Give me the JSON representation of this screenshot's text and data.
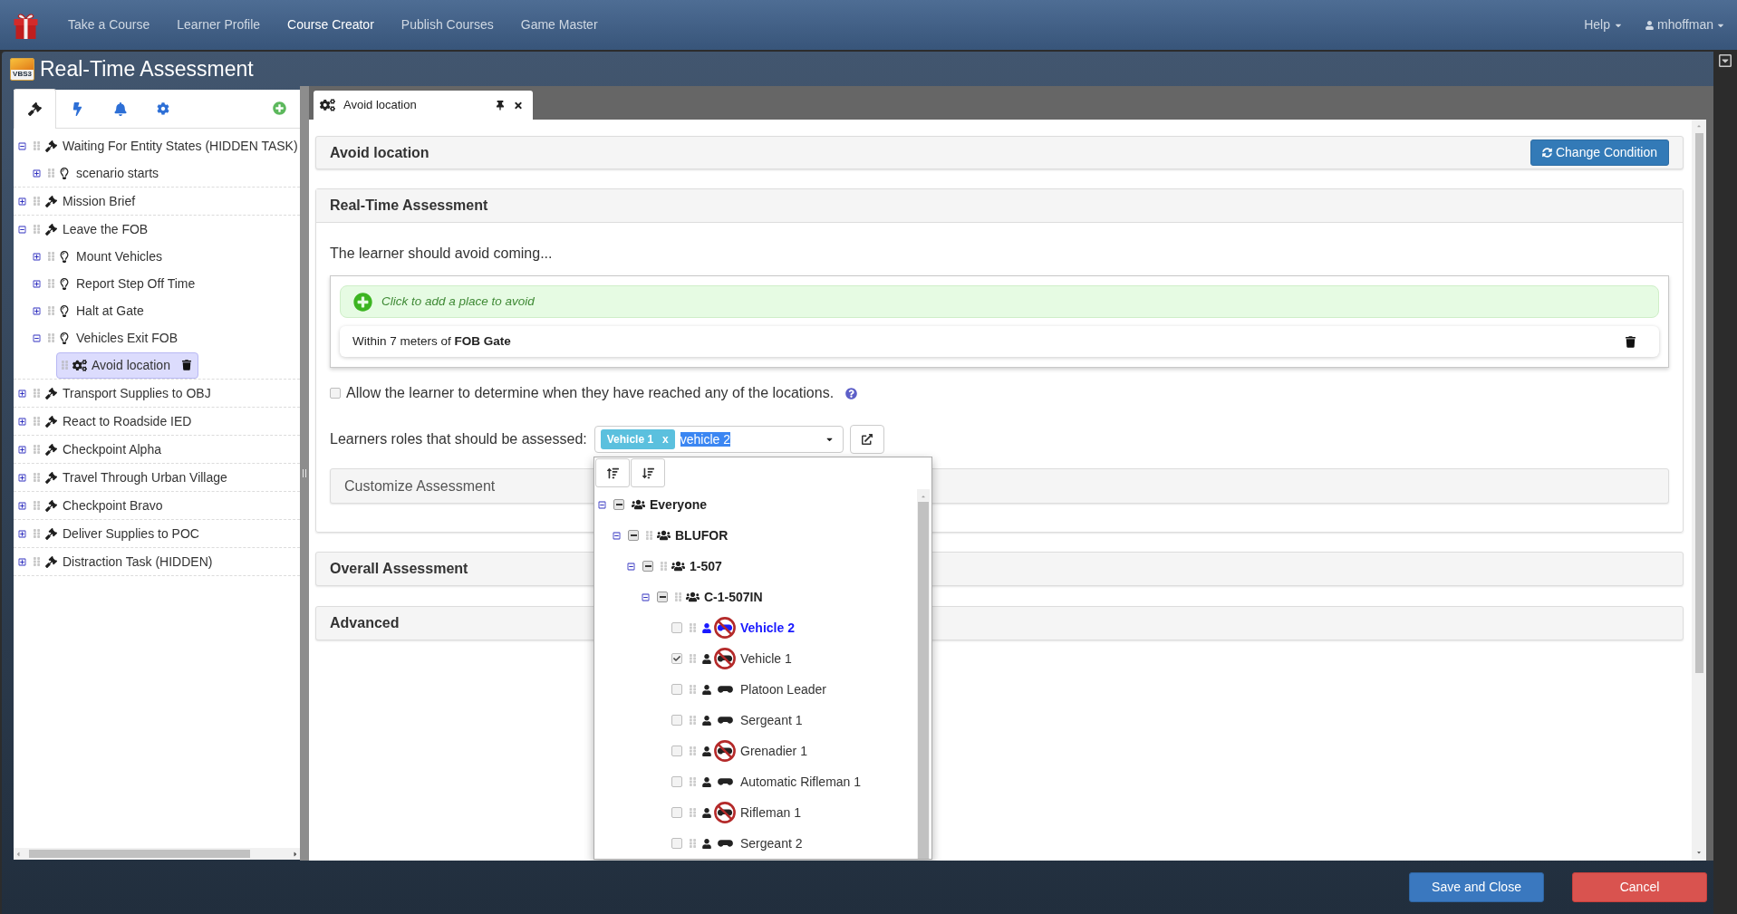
{
  "navbar": {
    "links": [
      {
        "label": "Take a Course",
        "selected": false
      },
      {
        "label": "Learner Profile",
        "selected": false
      },
      {
        "label": "Course Creator",
        "selected": true
      },
      {
        "label": "Publish Courses",
        "selected": false
      },
      {
        "label": "Game Master",
        "selected": false
      }
    ],
    "help": "Help",
    "user": "mhoffman"
  },
  "modal": {
    "logo_text": "VBS3",
    "title": "Real-Time Assessment"
  },
  "sidebar": {
    "tabs": [
      {
        "selected": true
      },
      {
        "selected": false
      },
      {
        "selected": false
      },
      {
        "selected": false
      }
    ],
    "tree": [
      {
        "kind": "task",
        "label": "Waiting For Entity States (HIDDEN TASK)",
        "expanded": true,
        "selected": false,
        "children": [
          {
            "kind": "step",
            "label": "scenario starts",
            "expanded": false,
            "selected": false
          }
        ]
      },
      {
        "kind": "task",
        "label": "Mission Brief",
        "expanded": false,
        "selected": false
      },
      {
        "kind": "task",
        "label": "Leave the FOB",
        "expanded": true,
        "selected": false,
        "children": [
          {
            "kind": "step",
            "label": "Mount Vehicles",
            "expanded": false,
            "selected": false
          },
          {
            "kind": "step",
            "label": "Report Step Off Time",
            "expanded": false,
            "selected": false
          },
          {
            "kind": "step",
            "label": "Halt at Gate",
            "expanded": false,
            "selected": false
          },
          {
            "kind": "step",
            "label": "Vehicles Exit FOB",
            "expanded": true,
            "selected": false,
            "children": [
              {
                "kind": "condition",
                "label": "Avoid location",
                "selected": true
              }
            ]
          }
        ]
      },
      {
        "kind": "task",
        "label": "Transport Supplies to OBJ",
        "expanded": false,
        "selected": false
      },
      {
        "kind": "task",
        "label": "React to Roadside IED",
        "expanded": false,
        "selected": false
      },
      {
        "kind": "task",
        "label": "Checkpoint Alpha",
        "expanded": false,
        "selected": false
      },
      {
        "kind": "task",
        "label": "Travel Through Urban Village",
        "expanded": false,
        "selected": false
      },
      {
        "kind": "task",
        "label": "Checkpoint Bravo",
        "expanded": false,
        "selected": false
      },
      {
        "kind": "task",
        "label": "Deliver Supplies to POC",
        "expanded": false,
        "selected": false
      },
      {
        "kind": "task",
        "label": "Distraction Task (HIDDEN)",
        "expanded": false,
        "selected": false
      }
    ]
  },
  "editor": {
    "tabs": [
      {
        "label": "Avoid location",
        "selected": true
      }
    ],
    "condition": {
      "title": "Avoid location",
      "button": "Change Condition"
    },
    "assessment": {
      "title": "Real-Time Assessment",
      "intro": "The learner should avoid coming...",
      "add_place": "Click to add a place to avoid",
      "locations": [
        {
          "text": "Within 7 meters of **FOB Gate**"
        }
      ],
      "allow_checkbox": {
        "label": "Allow the learner to determine when they have reached any of the locations.",
        "checked": false
      },
      "roles": {
        "label": "Learners roles that should be assessed:",
        "tags": [
          {
            "label": "Vehicle 1",
            "remove": "x"
          }
        ],
        "search": {
          "value": "vehicle 2",
          "text_selected": true
        }
      },
      "customize": {
        "title": "Customize Assessment"
      }
    },
    "sections": [
      {
        "title": "Overall Assessment"
      },
      {
        "title": "Advanced"
      }
    ]
  },
  "roles_dropdown": {
    "tree": [
      {
        "kind": "group",
        "label": "Everyone",
        "expanded": true,
        "partial": true,
        "children": [
          {
            "kind": "group",
            "label": "BLUFOR",
            "expanded": true,
            "partial": true,
            "children": [
              {
                "kind": "group",
                "label": "1-507",
                "expanded": true,
                "partial": true,
                "children": [
                  {
                    "kind": "group",
                    "label": "C-1-507IN",
                    "expanded": true,
                    "partial": true,
                    "children": [
                      {
                        "kind": "role",
                        "label": "Vehicle 2",
                        "checked": false,
                        "match": true,
                        "blocked": true
                      },
                      {
                        "kind": "role",
                        "label": "Vehicle 1",
                        "checked": true,
                        "match": false,
                        "blocked": true
                      },
                      {
                        "kind": "role",
                        "label": "Platoon Leader",
                        "checked": false,
                        "match": false,
                        "blocked": false
                      },
                      {
                        "kind": "role",
                        "label": "Sergeant 1",
                        "checked": false,
                        "match": false,
                        "blocked": false
                      },
                      {
                        "kind": "role",
                        "label": "Grenadier 1",
                        "checked": false,
                        "match": false,
                        "blocked": true
                      },
                      {
                        "kind": "role",
                        "label": "Automatic Rifleman 1",
                        "checked": false,
                        "match": false,
                        "blocked": false
                      },
                      {
                        "kind": "role",
                        "label": "Rifleman 1",
                        "checked": false,
                        "match": false,
                        "blocked": true
                      },
                      {
                        "kind": "role",
                        "label": "Sergeant 2",
                        "checked": false,
                        "match": false,
                        "blocked": false
                      }
                    ]
                  }
                ]
              }
            ]
          }
        ]
      }
    ]
  },
  "footer": {
    "buttons": [
      {
        "label": "Save and Close",
        "kind": "primary"
      },
      {
        "label": "Cancel",
        "kind": "danger"
      }
    ]
  }
}
